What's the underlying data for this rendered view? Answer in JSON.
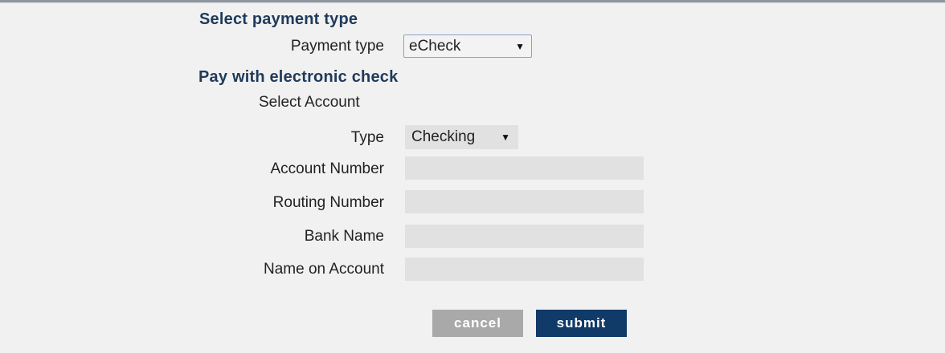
{
  "payment_type_section": {
    "heading": "Select payment type",
    "label": "Payment type",
    "selected": "eCheck"
  },
  "echeck_section": {
    "heading": "Pay with electronic check",
    "select_account_label": "Select Account",
    "type_label": "Type",
    "type_selected": "Checking",
    "account_number_label": "Account Number",
    "routing_number_label": "Routing Number",
    "bank_name_label": "Bank Name",
    "name_on_account_label": "Name on Account"
  },
  "buttons": {
    "cancel": "cancel",
    "submit": "submit"
  },
  "icons": {
    "dropdown_caret": "▼"
  }
}
